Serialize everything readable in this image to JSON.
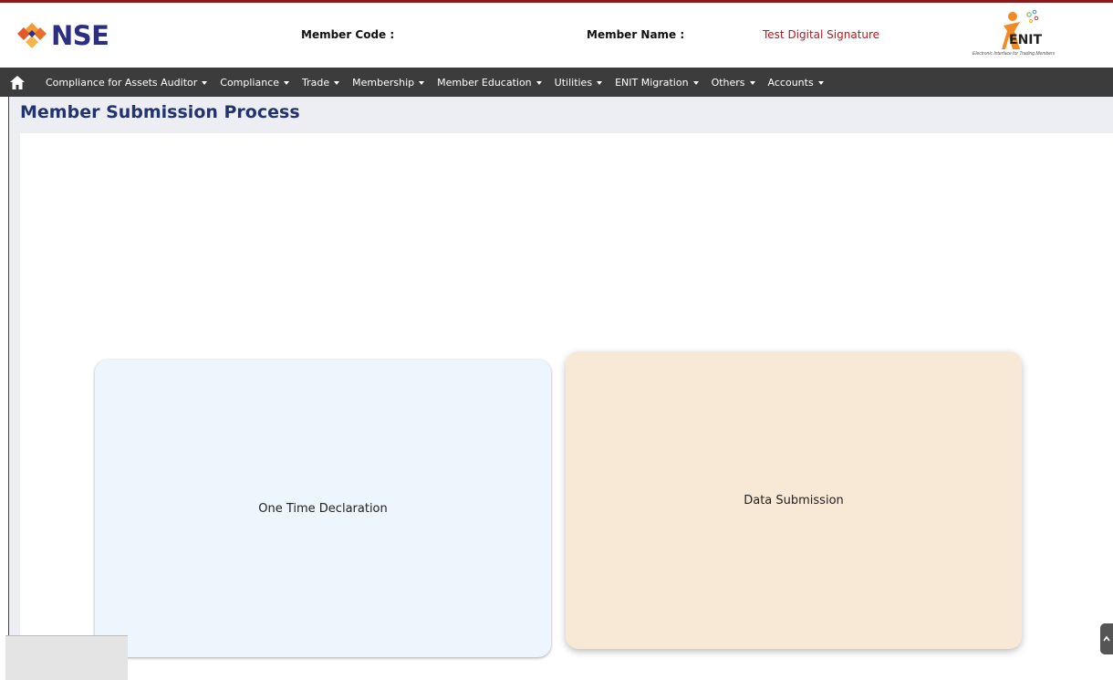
{
  "header": {
    "logo_text": "NSE",
    "member_code_label": "Member Code :",
    "member_code_value": "",
    "member_name_label": "Member Name :",
    "member_name_value": "Test Digital Signature",
    "enit_logo_text": "ENIT",
    "enit_tagline": "Electronic Interface for Trading Members"
  },
  "nav": {
    "items": [
      {
        "label": "Compliance for Assets Auditor"
      },
      {
        "label": "Compliance"
      },
      {
        "label": "Trade"
      },
      {
        "label": "Membership"
      },
      {
        "label": "Member Education"
      },
      {
        "label": "Utilities"
      },
      {
        "label": "ENIT Migration"
      },
      {
        "label": "Others"
      },
      {
        "label": "Accounts"
      }
    ]
  },
  "page": {
    "title": "Member Submission Process"
  },
  "cards": [
    {
      "label": "One Time Declaration",
      "color": "#edf5fd"
    },
    {
      "label": "Data Submission",
      "color": "#f8e9d6"
    }
  ],
  "colors": {
    "navbar": "#3c3c3c",
    "title": "#23336e",
    "member_name": "#c0131c",
    "brand": "#2b2e83"
  }
}
